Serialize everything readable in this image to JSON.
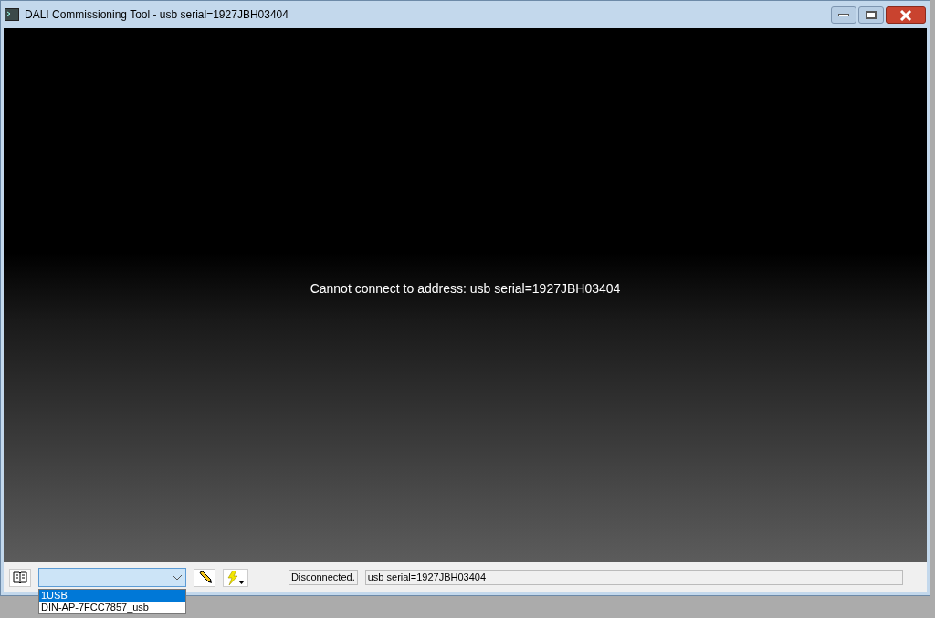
{
  "window": {
    "title": "DALI Commissioning Tool - usb serial=1927JBH03404"
  },
  "message": "Cannot connect to address: usb serial=1927JBH03404",
  "combo": {
    "expanded": true,
    "options": [
      {
        "label": "1USB",
        "selected": true
      },
      {
        "label": "DIN-AP-7FCC7857_usb",
        "selected": false
      }
    ]
  },
  "status_bar": {
    "status": "Disconnected.",
    "address": "usb serial=1927JBH03404"
  }
}
